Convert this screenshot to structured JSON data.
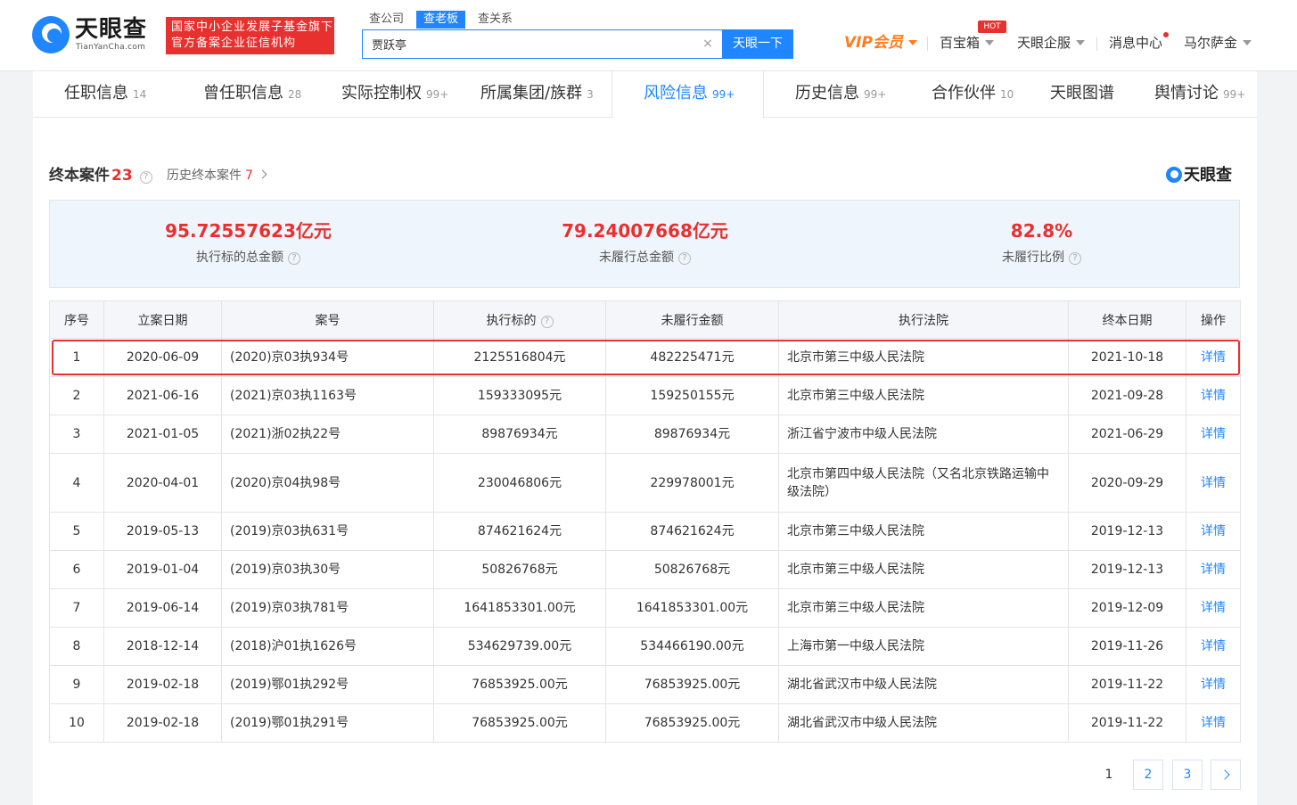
{
  "header": {
    "logo_name": "天眼查",
    "logo_sub": "TianYanCha.com",
    "gov_badge": [
      "国家中小企业发展子基金旗下",
      "官方备案企业征信机构"
    ],
    "search_tabs": [
      "查公司",
      "查老板",
      "查关系"
    ],
    "active_search_tab": "查老板",
    "search_value": "贾跃亭",
    "search_clear": "×",
    "search_button": "天眼一下",
    "vip_label": "VIP会员",
    "toolbox_label": "百宝箱",
    "hot_badge": "HOT",
    "enterprise_label": "天眼企服",
    "message_label": "消息中心",
    "user_name": "马尔萨金"
  },
  "tabs": [
    {
      "label": "任职信息",
      "count": "14"
    },
    {
      "label": "曾任职信息",
      "count": "28"
    },
    {
      "label": "实际控制权",
      "count": "99+"
    },
    {
      "label": "所属集团/族群",
      "count": "3"
    },
    {
      "label": "风险信息",
      "count": "99+",
      "active": true
    },
    {
      "label": "历史信息",
      "count": "99+"
    },
    {
      "label": "合作伙伴",
      "count": "10"
    },
    {
      "label": "天眼图谱",
      "count": ""
    },
    {
      "label": "舆情讨论",
      "count": "99+"
    }
  ],
  "section": {
    "title": "终本案件",
    "count": "23",
    "history_label": "历史终本案件",
    "history_count": "7",
    "brand": "天眼查"
  },
  "stats": [
    {
      "value": "95.72557623亿元",
      "label": "执行标的总金额"
    },
    {
      "value": "79.24007668亿元",
      "label": "未履行总金额"
    },
    {
      "value": "82.8%",
      "label": "未履行比例"
    }
  ],
  "table": {
    "headers": [
      "序号",
      "立案日期",
      "案号",
      "执行标的",
      "未履行金额",
      "执行法院",
      "终本日期",
      "操作"
    ],
    "rows": [
      [
        "1",
        "2020-06-09",
        "(2020)京03执934号",
        "2125516804元",
        "482225471元",
        "北京市第三中级人民法院",
        "2021-10-18",
        "详情"
      ],
      [
        "2",
        "2021-06-16",
        "(2021)京03执1163号",
        "159333095元",
        "159250155元",
        "北京市第三中级人民法院",
        "2021-09-28",
        "详情"
      ],
      [
        "3",
        "2021-01-05",
        "(2021)浙02执22号",
        "89876934元",
        "89876934元",
        "浙江省宁波市中级人民法院",
        "2021-06-29",
        "详情"
      ],
      [
        "4",
        "2020-04-01",
        "(2020)京04执98号",
        "230046806元",
        "229978001元",
        "北京市第四中级人民法院（又名北京铁路运输中级法院）",
        "2020-09-29",
        "详情"
      ],
      [
        "5",
        "2019-05-13",
        "(2019)京03执631号",
        "874621624元",
        "874621624元",
        "北京市第三中级人民法院",
        "2019-12-13",
        "详情"
      ],
      [
        "6",
        "2019-01-04",
        "(2019)京03执30号",
        "50826768元",
        "50826768元",
        "北京市第三中级人民法院",
        "2019-12-13",
        "详情"
      ],
      [
        "7",
        "2019-06-14",
        "(2019)京03执781号",
        "1641853301.00元",
        "1641853301.00元",
        "北京市第三中级人民法院",
        "2019-12-09",
        "详情"
      ],
      [
        "8",
        "2018-12-14",
        "(2018)沪01执1626号",
        "534629739.00元",
        "534466190.00元",
        "上海市第一中级人民法院",
        "2019-11-26",
        "详情"
      ],
      [
        "9",
        "2019-02-18",
        "(2019)鄂01执292号",
        "76853925.00元",
        "76853925.00元",
        "湖北省武汉市中级人民法院",
        "2019-11-22",
        "详情"
      ],
      [
        "10",
        "2019-02-18",
        "(2019)鄂01执291号",
        "76853925.00元",
        "76853925.00元",
        "湖北省武汉市中级人民法院",
        "2019-11-22",
        "详情"
      ]
    ]
  },
  "pagination": {
    "pages": [
      "1",
      "2",
      "3"
    ],
    "current": "1"
  },
  "colors": {
    "accent": "#1f86ff",
    "alert": "#e8302f",
    "vip": "#ff7d1f"
  }
}
